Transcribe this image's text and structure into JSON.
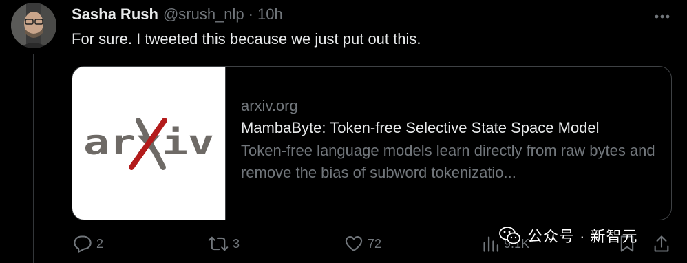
{
  "tweet": {
    "author_name": "Sasha Rush",
    "handle": "@srush_nlp",
    "separator": "·",
    "time": "10h",
    "text": "For sure. I tweeted this because we just put out this."
  },
  "link_card": {
    "thumbnail_logo_text": "arXiv",
    "domain": "arxiv.org",
    "title": "MambaByte: Token-free Selective State Space Model",
    "description": "Token-free language models learn directly from raw bytes and remove the bias of subword tokenizatio..."
  },
  "actions": {
    "reply_count": "2",
    "retweet_count": "3",
    "like_count": "72",
    "views_count": "9.1K"
  },
  "watermark": {
    "text": "公众号 · 新智元"
  },
  "colors": {
    "background": "#000000",
    "primary_text": "#e7e9ea",
    "secondary_text": "#71767b",
    "border": "#3e4144",
    "arxiv_gray": "#6e6a66",
    "arxiv_red": "#b31b1b"
  }
}
